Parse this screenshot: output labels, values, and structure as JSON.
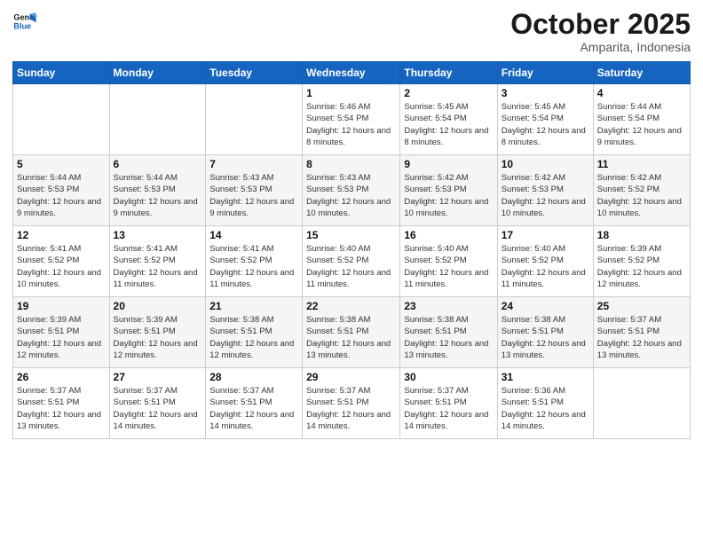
{
  "header": {
    "logo_general": "General",
    "logo_blue": "Blue",
    "month": "October 2025",
    "location": "Amparita, Indonesia"
  },
  "weekdays": [
    "Sunday",
    "Monday",
    "Tuesday",
    "Wednesday",
    "Thursday",
    "Friday",
    "Saturday"
  ],
  "weeks": [
    [
      {
        "day": "",
        "sunrise": "",
        "sunset": "",
        "daylight": ""
      },
      {
        "day": "",
        "sunrise": "",
        "sunset": "",
        "daylight": ""
      },
      {
        "day": "",
        "sunrise": "",
        "sunset": "",
        "daylight": ""
      },
      {
        "day": "1",
        "sunrise": "Sunrise: 5:46 AM",
        "sunset": "Sunset: 5:54 PM",
        "daylight": "Daylight: 12 hours and 8 minutes."
      },
      {
        "day": "2",
        "sunrise": "Sunrise: 5:45 AM",
        "sunset": "Sunset: 5:54 PM",
        "daylight": "Daylight: 12 hours and 8 minutes."
      },
      {
        "day": "3",
        "sunrise": "Sunrise: 5:45 AM",
        "sunset": "Sunset: 5:54 PM",
        "daylight": "Daylight: 12 hours and 8 minutes."
      },
      {
        "day": "4",
        "sunrise": "Sunrise: 5:44 AM",
        "sunset": "Sunset: 5:54 PM",
        "daylight": "Daylight: 12 hours and 9 minutes."
      }
    ],
    [
      {
        "day": "5",
        "sunrise": "Sunrise: 5:44 AM",
        "sunset": "Sunset: 5:53 PM",
        "daylight": "Daylight: 12 hours and 9 minutes."
      },
      {
        "day": "6",
        "sunrise": "Sunrise: 5:44 AM",
        "sunset": "Sunset: 5:53 PM",
        "daylight": "Daylight: 12 hours and 9 minutes."
      },
      {
        "day": "7",
        "sunrise": "Sunrise: 5:43 AM",
        "sunset": "Sunset: 5:53 PM",
        "daylight": "Daylight: 12 hours and 9 minutes."
      },
      {
        "day": "8",
        "sunrise": "Sunrise: 5:43 AM",
        "sunset": "Sunset: 5:53 PM",
        "daylight": "Daylight: 12 hours and 10 minutes."
      },
      {
        "day": "9",
        "sunrise": "Sunrise: 5:42 AM",
        "sunset": "Sunset: 5:53 PM",
        "daylight": "Daylight: 12 hours and 10 minutes."
      },
      {
        "day": "10",
        "sunrise": "Sunrise: 5:42 AM",
        "sunset": "Sunset: 5:53 PM",
        "daylight": "Daylight: 12 hours and 10 minutes."
      },
      {
        "day": "11",
        "sunrise": "Sunrise: 5:42 AM",
        "sunset": "Sunset: 5:52 PM",
        "daylight": "Daylight: 12 hours and 10 minutes."
      }
    ],
    [
      {
        "day": "12",
        "sunrise": "Sunrise: 5:41 AM",
        "sunset": "Sunset: 5:52 PM",
        "daylight": "Daylight: 12 hours and 10 minutes."
      },
      {
        "day": "13",
        "sunrise": "Sunrise: 5:41 AM",
        "sunset": "Sunset: 5:52 PM",
        "daylight": "Daylight: 12 hours and 11 minutes."
      },
      {
        "day": "14",
        "sunrise": "Sunrise: 5:41 AM",
        "sunset": "Sunset: 5:52 PM",
        "daylight": "Daylight: 12 hours and 11 minutes."
      },
      {
        "day": "15",
        "sunrise": "Sunrise: 5:40 AM",
        "sunset": "Sunset: 5:52 PM",
        "daylight": "Daylight: 12 hours and 11 minutes."
      },
      {
        "day": "16",
        "sunrise": "Sunrise: 5:40 AM",
        "sunset": "Sunset: 5:52 PM",
        "daylight": "Daylight: 12 hours and 11 minutes."
      },
      {
        "day": "17",
        "sunrise": "Sunrise: 5:40 AM",
        "sunset": "Sunset: 5:52 PM",
        "daylight": "Daylight: 12 hours and 11 minutes."
      },
      {
        "day": "18",
        "sunrise": "Sunrise: 5:39 AM",
        "sunset": "Sunset: 5:52 PM",
        "daylight": "Daylight: 12 hours and 12 minutes."
      }
    ],
    [
      {
        "day": "19",
        "sunrise": "Sunrise: 5:39 AM",
        "sunset": "Sunset: 5:51 PM",
        "daylight": "Daylight: 12 hours and 12 minutes."
      },
      {
        "day": "20",
        "sunrise": "Sunrise: 5:39 AM",
        "sunset": "Sunset: 5:51 PM",
        "daylight": "Daylight: 12 hours and 12 minutes."
      },
      {
        "day": "21",
        "sunrise": "Sunrise: 5:38 AM",
        "sunset": "Sunset: 5:51 PM",
        "daylight": "Daylight: 12 hours and 12 minutes."
      },
      {
        "day": "22",
        "sunrise": "Sunrise: 5:38 AM",
        "sunset": "Sunset: 5:51 PM",
        "daylight": "Daylight: 12 hours and 13 minutes."
      },
      {
        "day": "23",
        "sunrise": "Sunrise: 5:38 AM",
        "sunset": "Sunset: 5:51 PM",
        "daylight": "Daylight: 12 hours and 13 minutes."
      },
      {
        "day": "24",
        "sunrise": "Sunrise: 5:38 AM",
        "sunset": "Sunset: 5:51 PM",
        "daylight": "Daylight: 12 hours and 13 minutes."
      },
      {
        "day": "25",
        "sunrise": "Sunrise: 5:37 AM",
        "sunset": "Sunset: 5:51 PM",
        "daylight": "Daylight: 12 hours and 13 minutes."
      }
    ],
    [
      {
        "day": "26",
        "sunrise": "Sunrise: 5:37 AM",
        "sunset": "Sunset: 5:51 PM",
        "daylight": "Daylight: 12 hours and 13 minutes."
      },
      {
        "day": "27",
        "sunrise": "Sunrise: 5:37 AM",
        "sunset": "Sunset: 5:51 PM",
        "daylight": "Daylight: 12 hours and 14 minutes."
      },
      {
        "day": "28",
        "sunrise": "Sunrise: 5:37 AM",
        "sunset": "Sunset: 5:51 PM",
        "daylight": "Daylight: 12 hours and 14 minutes."
      },
      {
        "day": "29",
        "sunrise": "Sunrise: 5:37 AM",
        "sunset": "Sunset: 5:51 PM",
        "daylight": "Daylight: 12 hours and 14 minutes."
      },
      {
        "day": "30",
        "sunrise": "Sunrise: 5:37 AM",
        "sunset": "Sunset: 5:51 PM",
        "daylight": "Daylight: 12 hours and 14 minutes."
      },
      {
        "day": "31",
        "sunrise": "Sunrise: 5:36 AM",
        "sunset": "Sunset: 5:51 PM",
        "daylight": "Daylight: 12 hours and 14 minutes."
      },
      {
        "day": "",
        "sunrise": "",
        "sunset": "",
        "daylight": ""
      }
    ]
  ]
}
